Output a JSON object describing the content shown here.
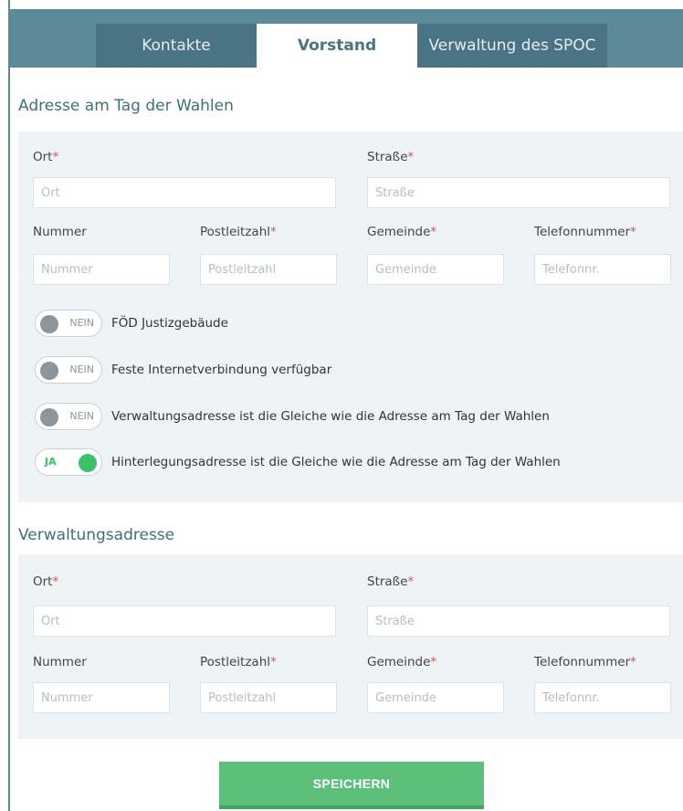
{
  "tabs": [
    {
      "label": "Kontakte",
      "active": false
    },
    {
      "label": "Vorstand",
      "active": true
    },
    {
      "label": "Verwaltung des SPOC",
      "active": false
    }
  ],
  "section1": {
    "title": "Adresse am Tag der Wahlen",
    "fields": {
      "ort": {
        "label": "Ort",
        "required": "*",
        "placeholder": "Ort",
        "value": ""
      },
      "strasse": {
        "label": "Straße",
        "required": "*",
        "placeholder": "Straße",
        "value": ""
      },
      "nummer": {
        "label": "Nummer",
        "placeholder": "Nummer",
        "value": ""
      },
      "plz": {
        "label": "Postleitzahl",
        "required": "*",
        "placeholder": "Postleitzahl",
        "value": ""
      },
      "gemeinde": {
        "label": "Gemeinde",
        "required": "*",
        "placeholder": "Gemeinde",
        "value": ""
      },
      "telefon": {
        "label": "Telefonnummer",
        "required": "*",
        "placeholder": "Telefonnr.",
        "value": ""
      }
    },
    "toggles": [
      {
        "state": "NEIN",
        "label": "FÖD Justizgebäude"
      },
      {
        "state": "NEIN",
        "label": "Feste Internetverbindung verfügbar"
      },
      {
        "state": "NEIN",
        "label": "Verwaltungsadresse ist die Gleiche wie die Adresse am Tag der Wahlen"
      },
      {
        "state": "JA",
        "label": "Hinterlegungsadresse ist die Gleiche wie die Adresse am Tag der Wahlen"
      }
    ]
  },
  "section2": {
    "title": "Verwaltungsadresse",
    "fields": {
      "ort": {
        "label": "Ort",
        "required": "*",
        "placeholder": "Ort",
        "value": ""
      },
      "strasse": {
        "label": "Straße",
        "required": "*",
        "placeholder": "Straße",
        "value": ""
      },
      "nummer": {
        "label": "Nummer",
        "placeholder": "Nummer",
        "value": ""
      },
      "plz": {
        "label": "Postleitzahl",
        "required": "*",
        "placeholder": "Postleitzahl",
        "value": ""
      },
      "gemeinde": {
        "label": "Gemeinde",
        "required": "*",
        "placeholder": "Gemeinde",
        "value": ""
      },
      "telefon": {
        "label": "Telefonnummer",
        "required": "*",
        "placeholder": "Telefonnr.",
        "value": ""
      }
    }
  },
  "save_label": "SPEICHERN",
  "colors": {
    "header": "#5b8a99",
    "tab_inactive": "#4a7484",
    "panel": "#eef3f5",
    "required": "#d9534f",
    "toggle_on": "#3cc06a",
    "toggle_off": "#8a959c",
    "save_button": "#5cc07a"
  }
}
